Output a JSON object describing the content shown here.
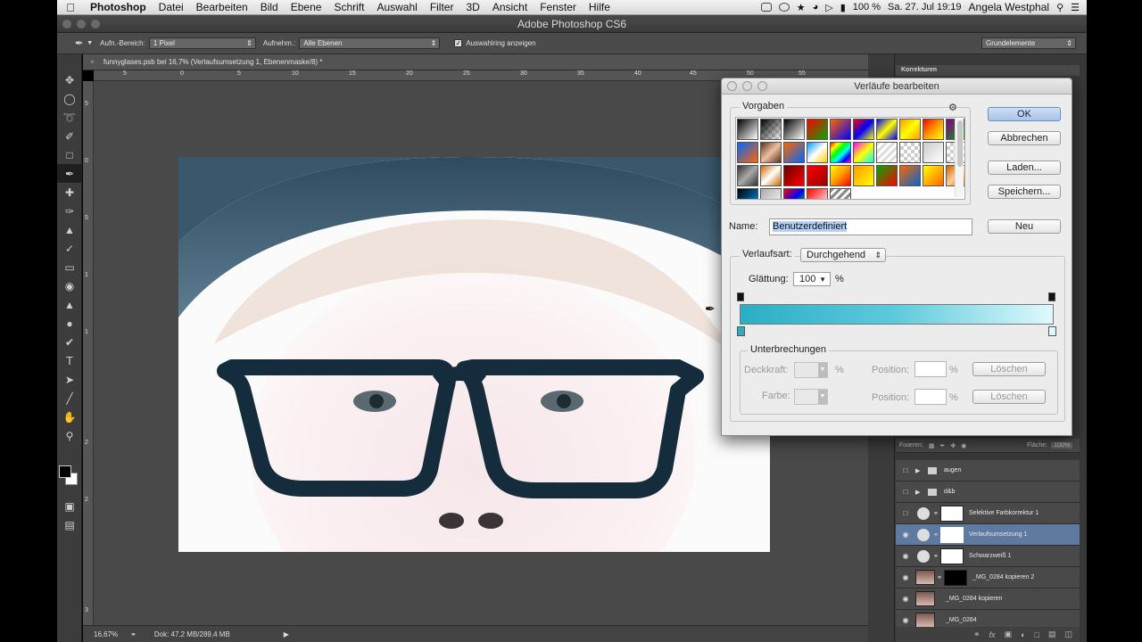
{
  "menubar": {
    "app": "Photoshop",
    "items": [
      "Datei",
      "Bearbeiten",
      "Bild",
      "Ebene",
      "Schrift",
      "Auswahl",
      "Filter",
      "3D",
      "Ansicht",
      "Fenster",
      "Hilfe"
    ],
    "battery": "100 %",
    "datetime": "Sa. 27. Jul  19:19",
    "user": "Angela Westphal"
  },
  "window": {
    "title": "Adobe Photoshop CS6"
  },
  "options": {
    "sample_size_label": "Aufn.-Bereich:",
    "sample_size_value": "1 Pixel",
    "sample_label": "Aufnehm.:",
    "sample_value": "Alle Ebenen",
    "show_ring_label": "Auswahlring anzeigen",
    "workspace": "Grundelemente"
  },
  "document": {
    "tab": "funnyglases.psb bei 16,7% (Verlaufsumsetzung 1, Ebenenmaske/8) *",
    "ruler_top": [
      "5",
      "0",
      "5",
      "10",
      "15",
      "20",
      "25",
      "30",
      "35",
      "40",
      "45",
      "50",
      "55"
    ],
    "ruler_left": [
      "5",
      "0",
      "5",
      "1",
      "1",
      "2",
      "2",
      "3"
    ],
    "zoom": "16,67%",
    "doc_size": "Dok: 47,2 MB/289,4 MB"
  },
  "panels": {
    "adjustments_tab": "Korrekturen",
    "lock_label": "Fixieren:",
    "fill_label": "Fläche:",
    "fill_value": "100%",
    "layers": [
      {
        "name": "augen",
        "kind": "group",
        "visible": false
      },
      {
        "name": "d&b",
        "kind": "group",
        "visible": false
      },
      {
        "name": "Selektive Farbkorrektur 1",
        "kind": "adjustment",
        "visible": false
      },
      {
        "name": "Verlaufsumsetzung 1",
        "kind": "adjustment",
        "visible": true,
        "selected": true
      },
      {
        "name": "Schwarzweiß 1",
        "kind": "adjustment",
        "visible": true
      },
      {
        "name": "_MG_0284 kopieren 2",
        "kind": "image-mask",
        "visible": true
      },
      {
        "name": "_MG_0284 kopieren",
        "kind": "image",
        "visible": true
      },
      {
        "name": "_MG_0284",
        "kind": "image",
        "visible": true
      }
    ]
  },
  "dialog": {
    "title": "Verläufe bearbeiten",
    "presets_label": "Vorgaben",
    "ok": "OK",
    "cancel": "Abbrechen",
    "load": "Laden...",
    "save": "Speichern...",
    "name_label": "Name:",
    "name_value": "Benutzerdefiniert",
    "new": "Neu",
    "type_label": "Verlaufsart:",
    "type_value": "Durchgehend",
    "smooth_label": "Glättung:",
    "smooth_value": "100",
    "smooth_unit": "%",
    "stops_label": "Unterbrechungen",
    "opacity_label": "Deckkraft:",
    "color_label": "Farbe:",
    "percent": "%",
    "position_label": "Position:",
    "delete": "Löschen",
    "gradient_colors": [
      "#2aaec4",
      "#dff9fd"
    ]
  }
}
